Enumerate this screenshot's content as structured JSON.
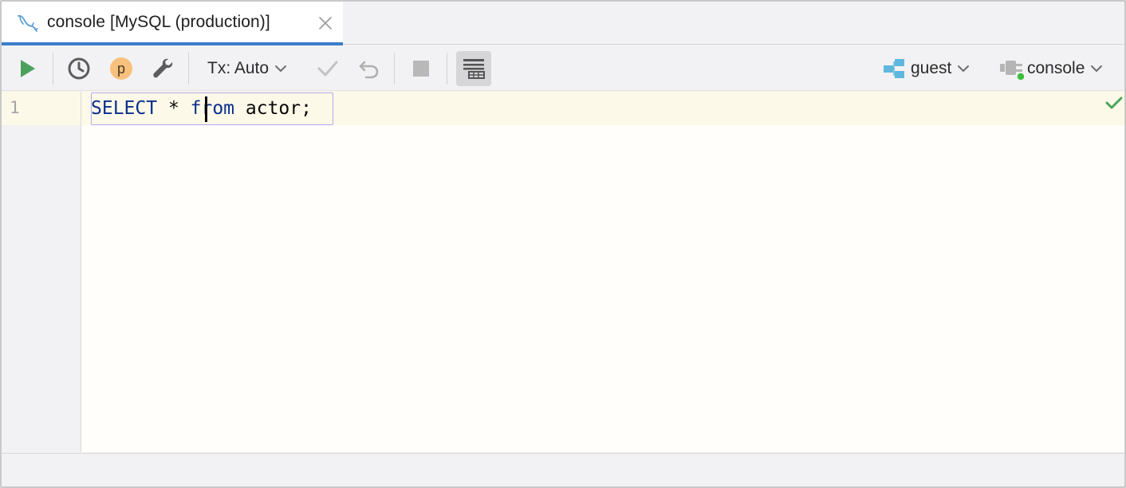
{
  "tab": {
    "icon": "mysql-dolphin-icon",
    "title": "console [MySQL (production)]",
    "close_icon": "close-icon"
  },
  "toolbar": {
    "execute_icon": "play-icon",
    "history_icon": "clock-icon",
    "profile_badge": "p",
    "settings_icon": "wrench-icon",
    "tx_label": "Tx: Auto",
    "commit_icon": "check-icon",
    "rollback_icon": "undo-icon",
    "stop_icon": "stop-icon",
    "output_icon": "table-output-icon",
    "schema_label": "guest",
    "schema_icon": "schema-icon",
    "session_label": "console",
    "session_icon": "session-icon",
    "colors": {
      "run": "#4d9f5c",
      "profile_badge": "#f7c17d",
      "tab_accent": "#3d7ec9",
      "keyword": "#0a2f8d"
    }
  },
  "editor": {
    "line_number": "1",
    "tokens": {
      "select": "SELECT",
      "star": " * ",
      "from": "from",
      "rest": " actor",
      "semicolon": ";"
    },
    "status_icon": "check-icon"
  }
}
